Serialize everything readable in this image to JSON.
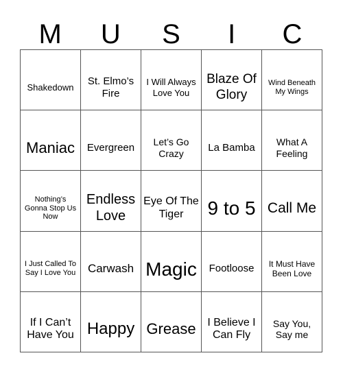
{
  "title_letters": [
    "M",
    "U",
    "S",
    "I",
    "C"
  ],
  "cells": [
    {
      "text": "Shakedown",
      "size": 13
    },
    {
      "text": "St. Elmo’s Fire",
      "size": 15
    },
    {
      "text": "I Will Always Love You",
      "size": 13
    },
    {
      "text": "Blaze Of Glory",
      "size": 19
    },
    {
      "text": "Wind Beneath My Wings",
      "size": 11
    },
    {
      "text": "Maniac",
      "size": 22
    },
    {
      "text": "Evergreen",
      "size": 15
    },
    {
      "text": "Let’s Go Crazy",
      "size": 14
    },
    {
      "text": "La Bamba",
      "size": 15
    },
    {
      "text": "What A Feeling",
      "size": 14
    },
    {
      "text": "Nothing’s Gonna Stop Us Now",
      "size": 11
    },
    {
      "text": "Endless Love",
      "size": 20
    },
    {
      "text": "Eye Of The Tiger",
      "size": 16
    },
    {
      "text": "9 to 5",
      "size": 28
    },
    {
      "text": "Call Me",
      "size": 21
    },
    {
      "text": "I Just Called To Say I Love You",
      "size": 11
    },
    {
      "text": "Carwash",
      "size": 17
    },
    {
      "text": "Magic",
      "size": 28
    },
    {
      "text": "Footloose",
      "size": 15
    },
    {
      "text": "It Must Have Been Love",
      "size": 12
    },
    {
      "text": "If I Can’t Have You",
      "size": 16
    },
    {
      "text": "Happy",
      "size": 24
    },
    {
      "text": "Grease",
      "size": 22
    },
    {
      "text": "I Believe I Can Fly",
      "size": 16
    },
    {
      "text": "Say You, Say me",
      "size": 14
    }
  ]
}
